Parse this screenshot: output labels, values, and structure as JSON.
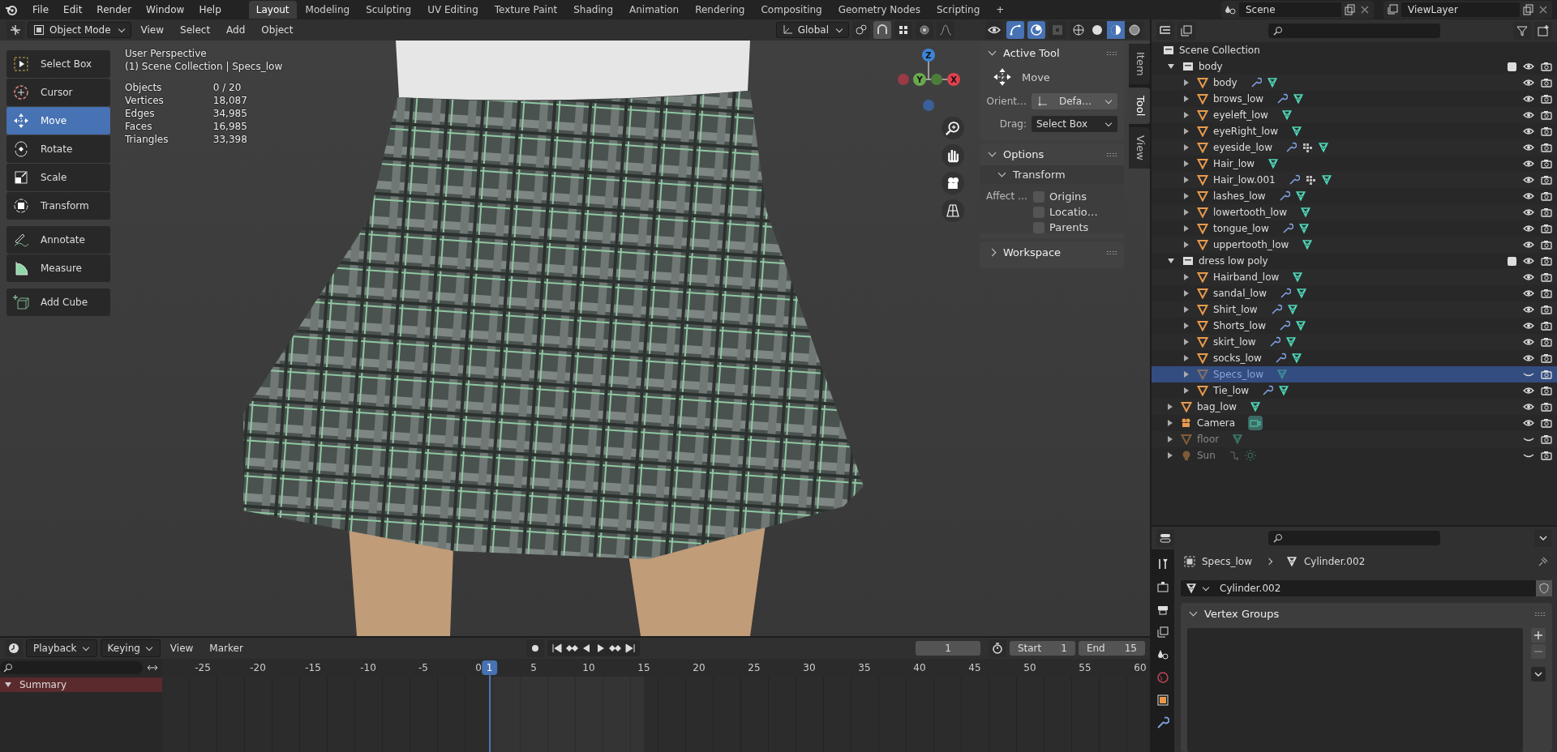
{
  "topbar": {
    "menus": [
      "File",
      "Edit",
      "Render",
      "Window",
      "Help"
    ],
    "workspaces": [
      {
        "label": "Layout",
        "selected": true
      },
      {
        "label": "Modeling",
        "selected": false
      },
      {
        "label": "Sculpting",
        "selected": false
      },
      {
        "label": "UV Editing",
        "selected": false
      },
      {
        "label": "Texture Paint",
        "selected": false
      },
      {
        "label": "Shading",
        "selected": false
      },
      {
        "label": "Animation",
        "selected": false
      },
      {
        "label": "Rendering",
        "selected": false
      },
      {
        "label": "Compositing",
        "selected": false
      },
      {
        "label": "Geometry Nodes",
        "selected": false
      },
      {
        "label": "Scripting",
        "selected": false
      }
    ],
    "add_tab": "+",
    "scene": "Scene",
    "view_layer": "ViewLayer"
  },
  "viewport": {
    "mode": "Object Mode",
    "menus": [
      "View",
      "Select",
      "Add",
      "Object"
    ],
    "orientation": "Global",
    "toolbar": [
      {
        "label": "Select Box",
        "selected": false
      },
      {
        "label": "Cursor",
        "selected": false
      },
      {
        "label": "Move",
        "selected": true
      },
      {
        "label": "Rotate",
        "selected": false
      },
      {
        "label": "Scale",
        "selected": false
      },
      {
        "label": "Transform",
        "selected": false
      },
      {
        "label": "Annotate",
        "selected": false
      },
      {
        "label": "Measure",
        "selected": false
      },
      {
        "label": "Add Cube",
        "selected": false
      }
    ],
    "info": {
      "title": "User Perspective",
      "context": "(1) Scene Collection | Specs_low",
      "stats": [
        {
          "label": "Objects",
          "value": "0 / 20"
        },
        {
          "label": "Vertices",
          "value": "18,087"
        },
        {
          "label": "Edges",
          "value": "34,985"
        },
        {
          "label": "Faces",
          "value": "16,985"
        },
        {
          "label": "Triangles",
          "value": "33,398"
        }
      ]
    },
    "gizmo_axes": [
      "Z",
      "Y",
      "X"
    ],
    "sidebar": {
      "tabs": [
        {
          "label": "Item",
          "selected": false
        },
        {
          "label": "Tool",
          "selected": true
        },
        {
          "label": "View",
          "selected": false
        }
      ],
      "active_tool": {
        "title": "Active Tool",
        "expanded": true,
        "tool": "Move",
        "orientation_label": "Orient…",
        "orientation_value": "Defa…",
        "drag_label": "Drag:",
        "drag_value": "Select Box"
      },
      "options": {
        "title": "Options",
        "expanded": true,
        "transform_title": "Transform",
        "affect_label": "Affect …",
        "checkboxes": [
          {
            "label": "Origins",
            "checked": false
          },
          {
            "label": "Locatio…",
            "checked": false
          },
          {
            "label": "Parents",
            "checked": false
          }
        ]
      },
      "workspace": {
        "title": "Workspace",
        "expanded": false
      }
    }
  },
  "outliner": {
    "root": "Scene Collection",
    "items": [
      {
        "name": "body",
        "kind": "collection",
        "expanded": true,
        "checked": true,
        "visible": true,
        "selected": false,
        "children": [
          {
            "name": "body",
            "kind": "mesh",
            "expanded": false,
            "visible": true,
            "selected": false,
            "has_modifier": true,
            "has_particles": false
          },
          {
            "name": "brows_low",
            "kind": "mesh",
            "expanded": false,
            "visible": true,
            "selected": false,
            "has_modifier": true,
            "has_particles": false
          },
          {
            "name": "eyeleft_low",
            "kind": "mesh",
            "expanded": false,
            "visible": true,
            "selected": false,
            "has_modifier": false,
            "has_particles": false
          },
          {
            "name": "eyeRight_low",
            "kind": "mesh",
            "expanded": false,
            "visible": true,
            "selected": false,
            "has_modifier": false,
            "has_particles": false
          },
          {
            "name": "eyeside_low",
            "kind": "mesh",
            "expanded": false,
            "visible": true,
            "selected": false,
            "has_modifier": true,
            "has_particles": true
          },
          {
            "name": "Hair_low",
            "kind": "mesh",
            "expanded": false,
            "visible": true,
            "selected": false,
            "has_modifier": false,
            "has_particles": false
          },
          {
            "name": "Hair_low.001",
            "kind": "mesh",
            "expanded": false,
            "visible": true,
            "selected": false,
            "has_modifier": true,
            "has_particles": true
          },
          {
            "name": "lashes_low",
            "kind": "mesh",
            "expanded": false,
            "visible": true,
            "selected": false,
            "has_modifier": true,
            "has_particles": false
          },
          {
            "name": "lowertooth_low",
            "kind": "mesh",
            "expanded": false,
            "visible": true,
            "selected": false,
            "has_modifier": false,
            "has_particles": false
          },
          {
            "name": "tongue_low",
            "kind": "mesh",
            "expanded": false,
            "visible": true,
            "selected": false,
            "has_modifier": true,
            "has_particles": false
          },
          {
            "name": "uppertooth_low",
            "kind": "mesh",
            "expanded": false,
            "visible": true,
            "selected": false,
            "has_modifier": false,
            "has_particles": false
          }
        ]
      },
      {
        "name": "dress low poly",
        "kind": "collection",
        "expanded": true,
        "checked": true,
        "visible": true,
        "selected": false,
        "children": [
          {
            "name": "Hairband_low",
            "kind": "mesh",
            "expanded": false,
            "visible": true,
            "selected": false,
            "has_modifier": false,
            "has_particles": false
          },
          {
            "name": "sandal_low",
            "kind": "mesh",
            "expanded": false,
            "visible": true,
            "selected": false,
            "has_modifier": true,
            "has_particles": false
          },
          {
            "name": "Shirt_low",
            "kind": "mesh",
            "expanded": false,
            "visible": true,
            "selected": false,
            "has_modifier": true,
            "has_particles": false
          },
          {
            "name": "Shorts_low",
            "kind": "mesh",
            "expanded": false,
            "visible": true,
            "selected": false,
            "has_modifier": true,
            "has_particles": false
          },
          {
            "name": "skirt_low",
            "kind": "mesh",
            "expanded": false,
            "visible": true,
            "selected": false,
            "has_modifier": true,
            "has_particles": false
          },
          {
            "name": "socks_low",
            "kind": "mesh",
            "expanded": false,
            "visible": true,
            "selected": false,
            "has_modifier": true,
            "has_particles": false
          },
          {
            "name": "Specs_low",
            "kind": "mesh",
            "expanded": false,
            "visible": false,
            "selected": true,
            "has_modifier": false,
            "has_particles": false
          },
          {
            "name": "Tie_low",
            "kind": "mesh",
            "expanded": false,
            "visible": true,
            "selected": false,
            "has_modifier": true,
            "has_particles": false
          }
        ]
      },
      {
        "name": "bag_low",
        "kind": "mesh",
        "expanded": false,
        "visible": true,
        "selected": false,
        "has_modifier": false,
        "has_particles": false
      },
      {
        "name": "Camera",
        "kind": "camera",
        "expanded": false,
        "visible": true,
        "selected": false,
        "has_modifier": false,
        "has_particles": false
      },
      {
        "name": "floor",
        "kind": "mesh",
        "expanded": false,
        "visible": false,
        "selected": false,
        "has_modifier": false,
        "has_particles": false
      },
      {
        "name": "Sun",
        "kind": "light",
        "expanded": false,
        "visible": false,
        "selected": false,
        "has_modifier": false,
        "has_particles": false
      }
    ]
  },
  "properties": {
    "object": "Specs_low",
    "data": "Cylinder.002",
    "datablock": "Cylinder.002",
    "panel": {
      "title": "Vertex Groups",
      "expanded": true
    }
  },
  "timeline": {
    "menus": [
      "Playback",
      "Keying",
      "View",
      "Marker"
    ],
    "current_frame": "1",
    "start_label": "Start",
    "start": "1",
    "end_label": "End",
    "end": "15",
    "ticks": [
      "-25",
      "-20",
      "-15",
      "-10",
      "-5",
      "0",
      "5",
      "10",
      "15",
      "20",
      "25",
      "30",
      "35",
      "40",
      "45",
      "50",
      "55",
      "60"
    ],
    "playhead": "1",
    "channels": [
      "Summary"
    ]
  }
}
